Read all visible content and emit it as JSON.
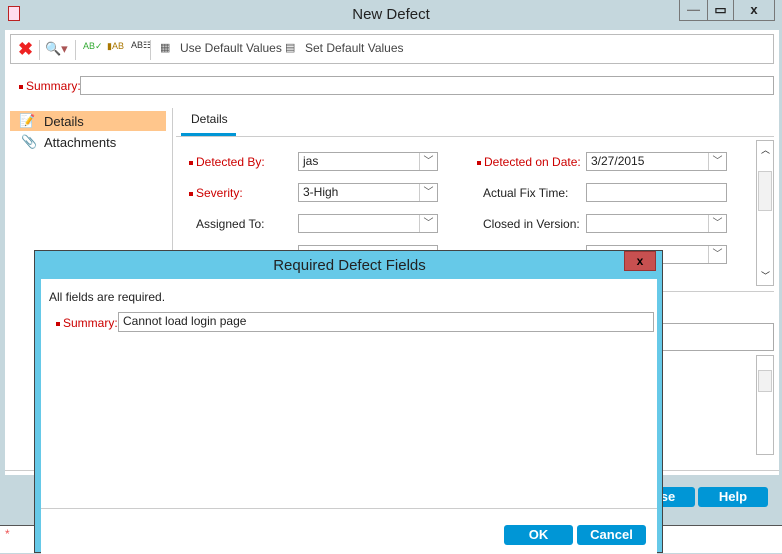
{
  "window": {
    "title": "New Defect",
    "minimize": "—",
    "maximize": "▭",
    "close": "x"
  },
  "toolbar": {
    "use_default": "Use Default Values",
    "set_default": "Set Default Values"
  },
  "summary": {
    "label": "Summary:",
    "value": ""
  },
  "sidebar": {
    "items": [
      {
        "label": "Details",
        "selected": true
      },
      {
        "label": "Attachments",
        "selected": false
      }
    ]
  },
  "tabs": [
    {
      "label": "Details"
    }
  ],
  "fields": {
    "detected_by": {
      "label": "Detected By:",
      "value": "jas"
    },
    "detected_on": {
      "label": "Detected on Date:",
      "value": "3/27/2015"
    },
    "severity": {
      "label": "Severity:",
      "value": "3-High"
    },
    "fix_time": {
      "label": "Actual Fix Time:",
      "value": ""
    },
    "assigned_to": {
      "label": "Assigned To:",
      "value": ""
    },
    "closed_in": {
      "label": "Closed in Version:",
      "value": ""
    }
  },
  "buttons": {
    "close": "Close",
    "help": "Help"
  },
  "status": {
    "asterisk": "*"
  },
  "dialog": {
    "title": "Required Defect Fields",
    "close": "x",
    "message": "All fields are required.",
    "summary_label": "Summary:",
    "summary_value": "Cannot load login page",
    "ok": "OK",
    "cancel": "Cancel"
  },
  "colors": {
    "dialog_title": "#66c9e8",
    "button": "#0096d6",
    "required": "#cc0000",
    "selected": "#ffc68c"
  }
}
